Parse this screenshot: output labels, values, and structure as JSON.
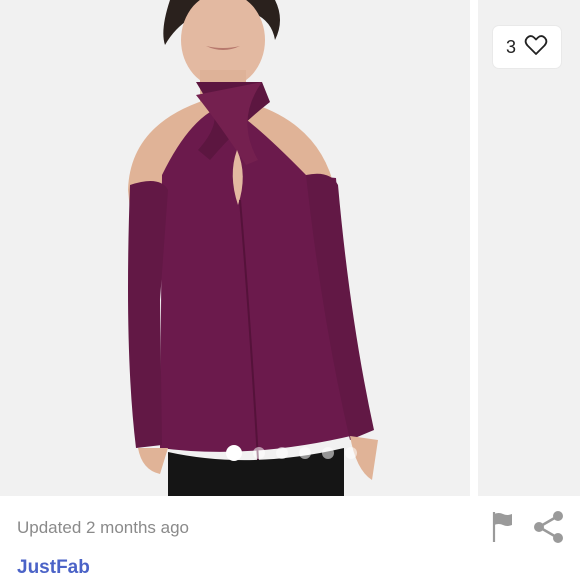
{
  "listing": {
    "like_count": "3",
    "updated_text": "Updated 2 months ago",
    "brand": "JustFab"
  },
  "gallery": {
    "dots_total": 6,
    "active_index": 0
  },
  "icons": [
    "heart-icon",
    "flag-icon",
    "share-icon"
  ],
  "colors": {
    "garment": "#6b1a4c",
    "brand_link": "#4b63c7",
    "meta_text": "#8a8a8a"
  }
}
